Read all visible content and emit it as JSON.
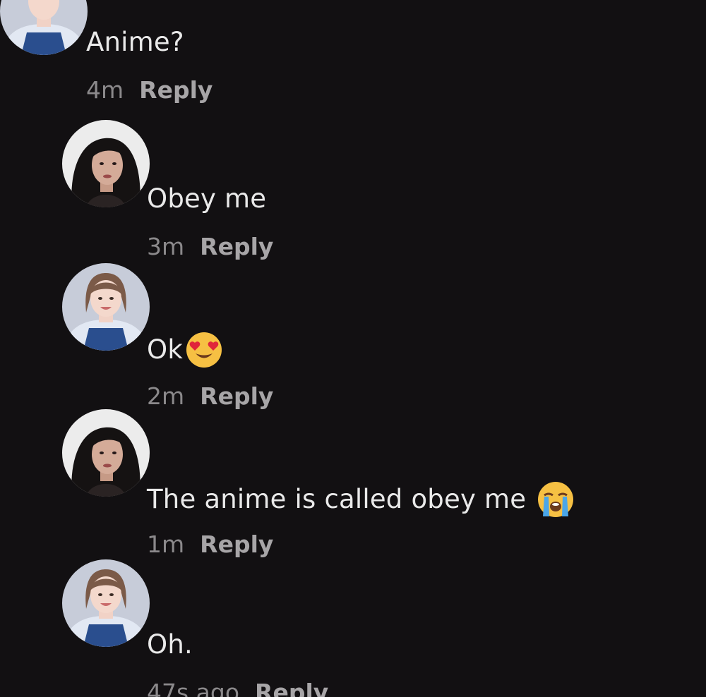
{
  "comments": [
    {
      "text": "Anime?",
      "time": "4m",
      "reply": "Reply",
      "avatar": "user-avatar-light"
    },
    {
      "text": "Obey me",
      "time": "3m",
      "reply": "Reply",
      "avatar": "user-avatar-dark"
    },
    {
      "text": "Ok",
      "time": "2m",
      "reply": "Reply",
      "avatar": "user-avatar-light",
      "emoji": "heart-eyes-emoji-icon"
    },
    {
      "text": "The anime is called obey me",
      "time": "1m",
      "reply": "Reply",
      "avatar": "user-avatar-dark",
      "emoji": "crying-emoji-icon"
    },
    {
      "text": "Oh.",
      "time": "47s ago",
      "reply": "Reply",
      "avatar": "user-avatar-light"
    }
  ],
  "colors": {
    "background": "#121012",
    "comment_text": "#e9e9e9",
    "meta_text": "#8b898b"
  }
}
